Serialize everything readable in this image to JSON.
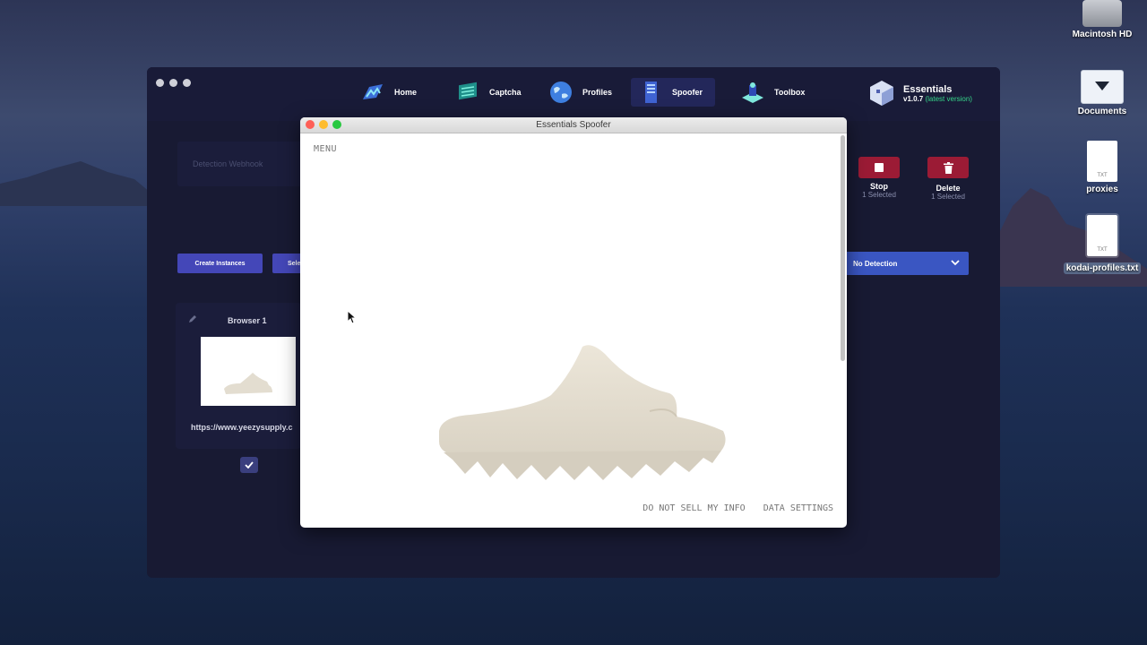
{
  "desktop": {
    "icons": [
      {
        "label": "Macintosh HD"
      },
      {
        "label": "Documents"
      },
      {
        "label": "proxies",
        "badge": "TXT"
      },
      {
        "label": "kodai-profiles.txt",
        "badge": "TXT"
      }
    ]
  },
  "app": {
    "nav": [
      {
        "label": "Home",
        "icon": "home-icon"
      },
      {
        "label": "Captcha",
        "icon": "captcha-icon"
      },
      {
        "label": "Profiles",
        "icon": "globe-icon"
      },
      {
        "label": "Spoofer",
        "icon": "server-icon",
        "active": true
      },
      {
        "label": "Toolbox",
        "icon": "toolbox-icon"
      }
    ],
    "brand": {
      "name": "Essentials",
      "version": "v1.0.7",
      "version_note": "(latest version)"
    },
    "webhook_placeholder": "Detection Webhook",
    "actions": {
      "stop": {
        "label": "Stop",
        "sub": "1 Selected"
      },
      "delete": {
        "label": "Delete",
        "sub": "1 Selected"
      }
    },
    "create_label": "Create Instances",
    "select_label": "Sele",
    "detection": "No Detection",
    "card": {
      "title": "Browser 1",
      "url": "https://www.yeezysupply.c"
    }
  },
  "spoofer": {
    "title": "Essentials Spoofer",
    "menu": "MENU",
    "footer": {
      "do_not_sell": "DO NOT SELL MY INFO",
      "data_settings": "DATA SETTINGS"
    }
  },
  "colors": {
    "accent": "#4447b8",
    "danger": "#9b1b35",
    "dropdown": "#3a56c2",
    "latest": "#36d68a"
  }
}
